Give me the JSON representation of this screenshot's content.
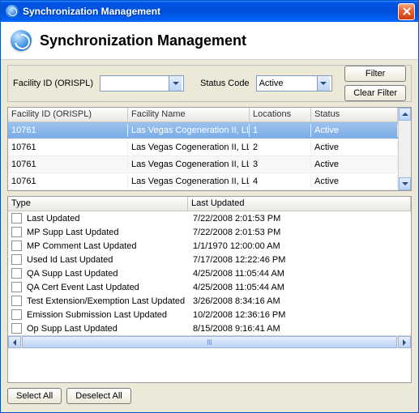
{
  "window": {
    "title": "Synchronization Management"
  },
  "header": {
    "title": "Synchronization Management"
  },
  "filter": {
    "facility_label": "Facility ID (ORISPL)",
    "facility_value": "",
    "status_label": "Status Code",
    "status_value": "Active",
    "filter_btn": "Filter",
    "clear_btn": "Clear Filter"
  },
  "grid": {
    "headers": {
      "facility_id": "Facility ID (ORISPL)",
      "facility_name": "Facility Name",
      "locations": "Locations",
      "status": "Status"
    },
    "rows": [
      {
        "facility_id": "10761",
        "facility_name": "Las Vegas Cogeneration II, LLC",
        "locations": "1",
        "status": "Active"
      },
      {
        "facility_id": "10761",
        "facility_name": "Las Vegas Cogeneration II, LLC",
        "locations": "2",
        "status": "Active"
      },
      {
        "facility_id": "10761",
        "facility_name": "Las Vegas Cogeneration II, LLC",
        "locations": "3",
        "status": "Active"
      },
      {
        "facility_id": "10761",
        "facility_name": "Las Vegas Cogeneration II, LLC",
        "locations": "4",
        "status": "Active"
      }
    ]
  },
  "detail": {
    "headers": {
      "type": "Type",
      "last_updated": "Last Updated"
    },
    "rows": [
      {
        "type": "Last Updated",
        "last": "7/22/2008 2:01:53 PM"
      },
      {
        "type": "MP Supp Last Updated",
        "last": "7/22/2008 2:01:53 PM"
      },
      {
        "type": "MP Comment Last Updated",
        "last": "1/1/1970 12:00:00 AM"
      },
      {
        "type": "Used Id Last Updated",
        "last": "7/17/2008 12:22:46 PM"
      },
      {
        "type": "QA Supp Last Updated",
        "last": "4/25/2008 11:05:44 AM"
      },
      {
        "type": "QA Cert Event Last Updated",
        "last": "4/25/2008 11:05:44 AM"
      },
      {
        "type": "Test Extension/Exemption Last Updated",
        "last": "3/26/2008 8:34:16 AM"
      },
      {
        "type": "Emission Submission Last Updated",
        "last": "10/2/2008 12:36:16 PM"
      },
      {
        "type": "Op Supp Last Updated",
        "last": "8/15/2008 9:16:41 AM"
      }
    ]
  },
  "buttons": {
    "select_all": "Select All",
    "deselect_all": "Deselect All"
  }
}
